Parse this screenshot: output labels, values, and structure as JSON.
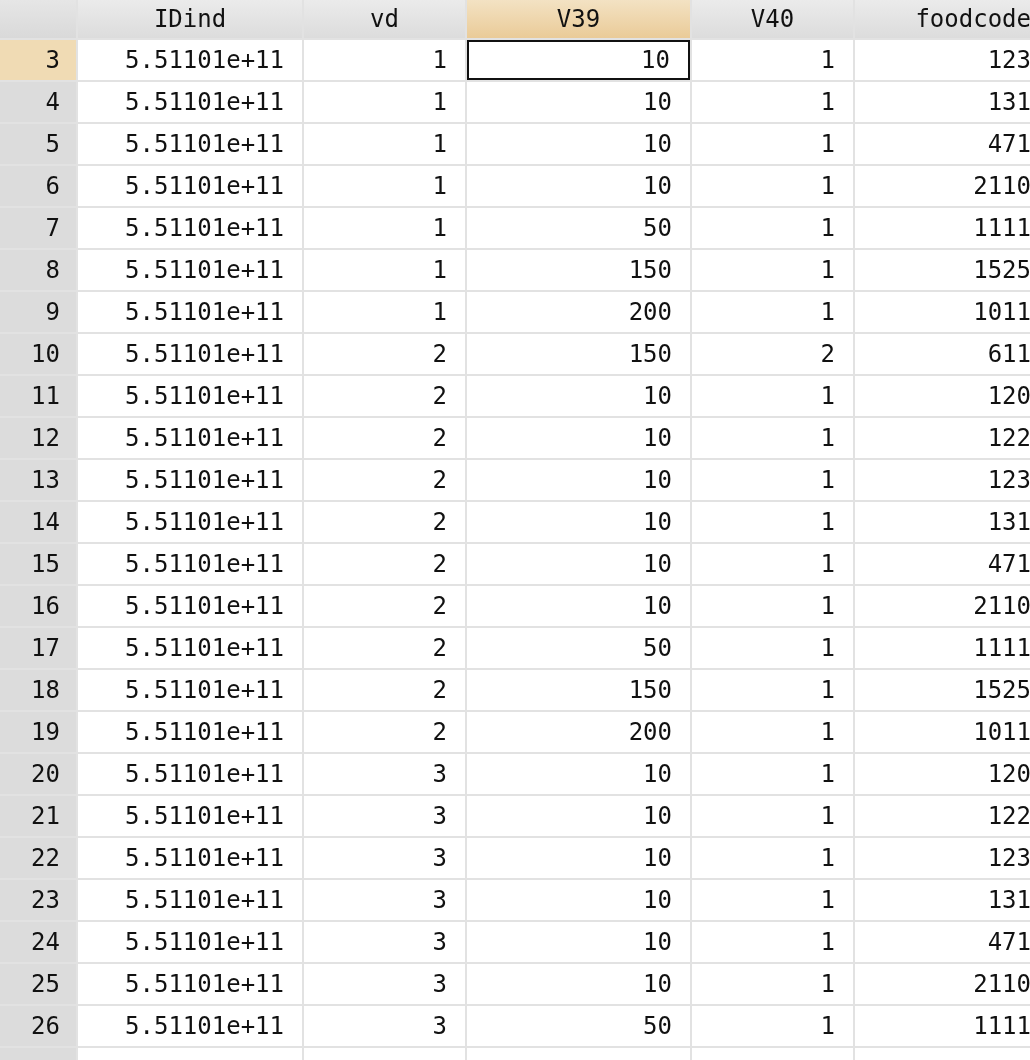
{
  "table": {
    "columns": [
      {
        "label": "IDind",
        "selected": false
      },
      {
        "label": "vd",
        "selected": false
      },
      {
        "label": "V39",
        "selected": true
      },
      {
        "label": "V40",
        "selected": false
      },
      {
        "label": "foodcode",
        "selected": false
      }
    ],
    "rows": [
      {
        "number": "3",
        "selected": true,
        "cells": [
          {
            "value": "5.51101e+11",
            "current": false
          },
          {
            "value": "1",
            "current": false
          },
          {
            "value": "10",
            "current": true
          },
          {
            "value": "1",
            "current": false
          },
          {
            "value": "123",
            "current": false
          }
        ]
      },
      {
        "number": "4",
        "selected": false,
        "cells": [
          {
            "value": "5.51101e+11",
            "current": false
          },
          {
            "value": "1",
            "current": false
          },
          {
            "value": "10",
            "current": false
          },
          {
            "value": "1",
            "current": false
          },
          {
            "value": "131",
            "current": false
          }
        ]
      },
      {
        "number": "5",
        "selected": false,
        "cells": [
          {
            "value": "5.51101e+11",
            "current": false
          },
          {
            "value": "1",
            "current": false
          },
          {
            "value": "10",
            "current": false
          },
          {
            "value": "1",
            "current": false
          },
          {
            "value": "471",
            "current": false
          }
        ]
      },
      {
        "number": "6",
        "selected": false,
        "cells": [
          {
            "value": "5.51101e+11",
            "current": false
          },
          {
            "value": "1",
            "current": false
          },
          {
            "value": "10",
            "current": false
          },
          {
            "value": "1",
            "current": false
          },
          {
            "value": "2110",
            "current": false
          }
        ]
      },
      {
        "number": "7",
        "selected": false,
        "cells": [
          {
            "value": "5.51101e+11",
            "current": false
          },
          {
            "value": "1",
            "current": false
          },
          {
            "value": "50",
            "current": false
          },
          {
            "value": "1",
            "current": false
          },
          {
            "value": "1111",
            "current": false
          }
        ]
      },
      {
        "number": "8",
        "selected": false,
        "cells": [
          {
            "value": "5.51101e+11",
            "current": false
          },
          {
            "value": "1",
            "current": false
          },
          {
            "value": "150",
            "current": false
          },
          {
            "value": "1",
            "current": false
          },
          {
            "value": "1525",
            "current": false
          }
        ]
      },
      {
        "number": "9",
        "selected": false,
        "cells": [
          {
            "value": "5.51101e+11",
            "current": false
          },
          {
            "value": "1",
            "current": false
          },
          {
            "value": "200",
            "current": false
          },
          {
            "value": "1",
            "current": false
          },
          {
            "value": "1011",
            "current": false
          }
        ]
      },
      {
        "number": "10",
        "selected": false,
        "cells": [
          {
            "value": "5.51101e+11",
            "current": false
          },
          {
            "value": "2",
            "current": false
          },
          {
            "value": "150",
            "current": false
          },
          {
            "value": "2",
            "current": false
          },
          {
            "value": "611",
            "current": false
          }
        ]
      },
      {
        "number": "11",
        "selected": false,
        "cells": [
          {
            "value": "5.51101e+11",
            "current": false
          },
          {
            "value": "2",
            "current": false
          },
          {
            "value": "10",
            "current": false
          },
          {
            "value": "1",
            "current": false
          },
          {
            "value": "120",
            "current": false
          }
        ]
      },
      {
        "number": "12",
        "selected": false,
        "cells": [
          {
            "value": "5.51101e+11",
            "current": false
          },
          {
            "value": "2",
            "current": false
          },
          {
            "value": "10",
            "current": false
          },
          {
            "value": "1",
            "current": false
          },
          {
            "value": "122",
            "current": false
          }
        ]
      },
      {
        "number": "13",
        "selected": false,
        "cells": [
          {
            "value": "5.51101e+11",
            "current": false
          },
          {
            "value": "2",
            "current": false
          },
          {
            "value": "10",
            "current": false
          },
          {
            "value": "1",
            "current": false
          },
          {
            "value": "123",
            "current": false
          }
        ]
      },
      {
        "number": "14",
        "selected": false,
        "cells": [
          {
            "value": "5.51101e+11",
            "current": false
          },
          {
            "value": "2",
            "current": false
          },
          {
            "value": "10",
            "current": false
          },
          {
            "value": "1",
            "current": false
          },
          {
            "value": "131",
            "current": false
          }
        ]
      },
      {
        "number": "15",
        "selected": false,
        "cells": [
          {
            "value": "5.51101e+11",
            "current": false
          },
          {
            "value": "2",
            "current": false
          },
          {
            "value": "10",
            "current": false
          },
          {
            "value": "1",
            "current": false
          },
          {
            "value": "471",
            "current": false
          }
        ]
      },
      {
        "number": "16",
        "selected": false,
        "cells": [
          {
            "value": "5.51101e+11",
            "current": false
          },
          {
            "value": "2",
            "current": false
          },
          {
            "value": "10",
            "current": false
          },
          {
            "value": "1",
            "current": false
          },
          {
            "value": "2110",
            "current": false
          }
        ]
      },
      {
        "number": "17",
        "selected": false,
        "cells": [
          {
            "value": "5.51101e+11",
            "current": false
          },
          {
            "value": "2",
            "current": false
          },
          {
            "value": "50",
            "current": false
          },
          {
            "value": "1",
            "current": false
          },
          {
            "value": "1111",
            "current": false
          }
        ]
      },
      {
        "number": "18",
        "selected": false,
        "cells": [
          {
            "value": "5.51101e+11",
            "current": false
          },
          {
            "value": "2",
            "current": false
          },
          {
            "value": "150",
            "current": false
          },
          {
            "value": "1",
            "current": false
          },
          {
            "value": "1525",
            "current": false
          }
        ]
      },
      {
        "number": "19",
        "selected": false,
        "cells": [
          {
            "value": "5.51101e+11",
            "current": false
          },
          {
            "value": "2",
            "current": false
          },
          {
            "value": "200",
            "current": false
          },
          {
            "value": "1",
            "current": false
          },
          {
            "value": "1011",
            "current": false
          }
        ]
      },
      {
        "number": "20",
        "selected": false,
        "cells": [
          {
            "value": "5.51101e+11",
            "current": false
          },
          {
            "value": "3",
            "current": false
          },
          {
            "value": "10",
            "current": false
          },
          {
            "value": "1",
            "current": false
          },
          {
            "value": "120",
            "current": false
          }
        ]
      },
      {
        "number": "21",
        "selected": false,
        "cells": [
          {
            "value": "5.51101e+11",
            "current": false
          },
          {
            "value": "3",
            "current": false
          },
          {
            "value": "10",
            "current": false
          },
          {
            "value": "1",
            "current": false
          },
          {
            "value": "122",
            "current": false
          }
        ]
      },
      {
        "number": "22",
        "selected": false,
        "cells": [
          {
            "value": "5.51101e+11",
            "current": false
          },
          {
            "value": "3",
            "current": false
          },
          {
            "value": "10",
            "current": false
          },
          {
            "value": "1",
            "current": false
          },
          {
            "value": "123",
            "current": false
          }
        ]
      },
      {
        "number": "23",
        "selected": false,
        "cells": [
          {
            "value": "5.51101e+11",
            "current": false
          },
          {
            "value": "3",
            "current": false
          },
          {
            "value": "10",
            "current": false
          },
          {
            "value": "1",
            "current": false
          },
          {
            "value": "131",
            "current": false
          }
        ]
      },
      {
        "number": "24",
        "selected": false,
        "cells": [
          {
            "value": "5.51101e+11",
            "current": false
          },
          {
            "value": "3",
            "current": false
          },
          {
            "value": "10",
            "current": false
          },
          {
            "value": "1",
            "current": false
          },
          {
            "value": "471",
            "current": false
          }
        ]
      },
      {
        "number": "25",
        "selected": false,
        "cells": [
          {
            "value": "5.51101e+11",
            "current": false
          },
          {
            "value": "3",
            "current": false
          },
          {
            "value": "10",
            "current": false
          },
          {
            "value": "1",
            "current": false
          },
          {
            "value": "2110",
            "current": false
          }
        ]
      },
      {
        "number": "26",
        "selected": false,
        "cells": [
          {
            "value": "5.51101e+11",
            "current": false
          },
          {
            "value": "3",
            "current": false
          },
          {
            "value": "50",
            "current": false
          },
          {
            "value": "1",
            "current": false
          },
          {
            "value": "1111",
            "current": false
          }
        ]
      }
    ]
  }
}
